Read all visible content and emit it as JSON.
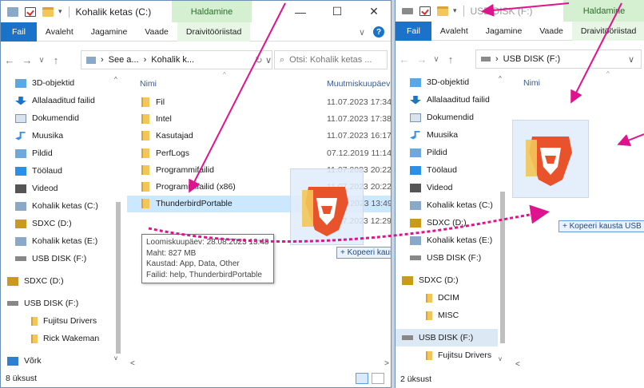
{
  "left": {
    "title": "Kohalik ketas (C:)",
    "ribbon_context": "Haldamine",
    "tabs": [
      "Fail",
      "Avaleht",
      "Jagamine",
      "Vaade",
      "Draivitööriistad"
    ],
    "address": [
      "See a...",
      "Kohalik k..."
    ],
    "search_placeholder": "Otsi: Kohalik ketas ...",
    "nav": [
      "3D-objektid",
      "Allalaaditud failid",
      "Dokumendid",
      "Muusika",
      "Pildid",
      "Töölaud",
      "Videod",
      "Kohalik ketas (C:)",
      "SDXC (D:)",
      "Kohalik ketas (E:)",
      "USB DISK (F:)",
      "SDXC (D:)",
      "USB DISK (F:)",
      "Fujitsu Drivers",
      "Rick Wakeman",
      "Võrk"
    ],
    "col_name": "Nimi",
    "col_date": "Muutmiskuupäev",
    "files": [
      {
        "name": "Fil",
        "date": "11.07.2023 17:34"
      },
      {
        "name": "Intel",
        "date": "11.07.2023 17:38"
      },
      {
        "name": "Kasutajad",
        "date": "11.07.2023 16:17"
      },
      {
        "name": "PerfLogs",
        "date": "07.12.2019 11:14"
      },
      {
        "name": "Programmifailid",
        "date": "11.07.2023 20:22"
      },
      {
        "name": "Programmifailid (x86)",
        "date": "11.07.2023 20:22"
      },
      {
        "name": "ThunderbirdPortable",
        "date": "28.08.2023 13:49"
      },
      {
        "name": "",
        "date": "11.07.2023 12:29"
      }
    ],
    "tooltip": [
      "Loomiskuupäev: 28.08.2023 13:48",
      "Maht: 827 MB",
      "Kaustad: App, Data, Other",
      "Failid: help, ThunderbirdPortable"
    ],
    "drag_label": "+ Kopeeri kausta Kohalik ketas (C:)",
    "status": "8 üksust"
  },
  "right": {
    "title": "USB DISK (F:)",
    "ribbon_context": "Haldamine",
    "tabs": [
      "Fail",
      "Avaleht",
      "Jagamine",
      "Vaade",
      "Draivitööriistad"
    ],
    "address": "USB DISK (F:)",
    "nav": [
      "3D-objektid",
      "Allalaaditud failid",
      "Dokumendid",
      "Muusika",
      "Pildid",
      "Töölaud",
      "Videod",
      "Kohalik ketas (C:)",
      "SDXC (D:)",
      "Kohalik ketas (E:)",
      "USB DISK (F:)",
      "SDXC (D:)",
      "DCIM",
      "MISC",
      "USB DISK (F:)",
      "Fujitsu Drivers"
    ],
    "col_name": "Nimi",
    "drag_label": "+ Kopeeri kausta USB DISK (F:)",
    "status": "2 üksust"
  },
  "colors": {
    "accent": "#1a73c9",
    "arrow": "#e0138f",
    "context_tab": "#d4f0d0"
  }
}
